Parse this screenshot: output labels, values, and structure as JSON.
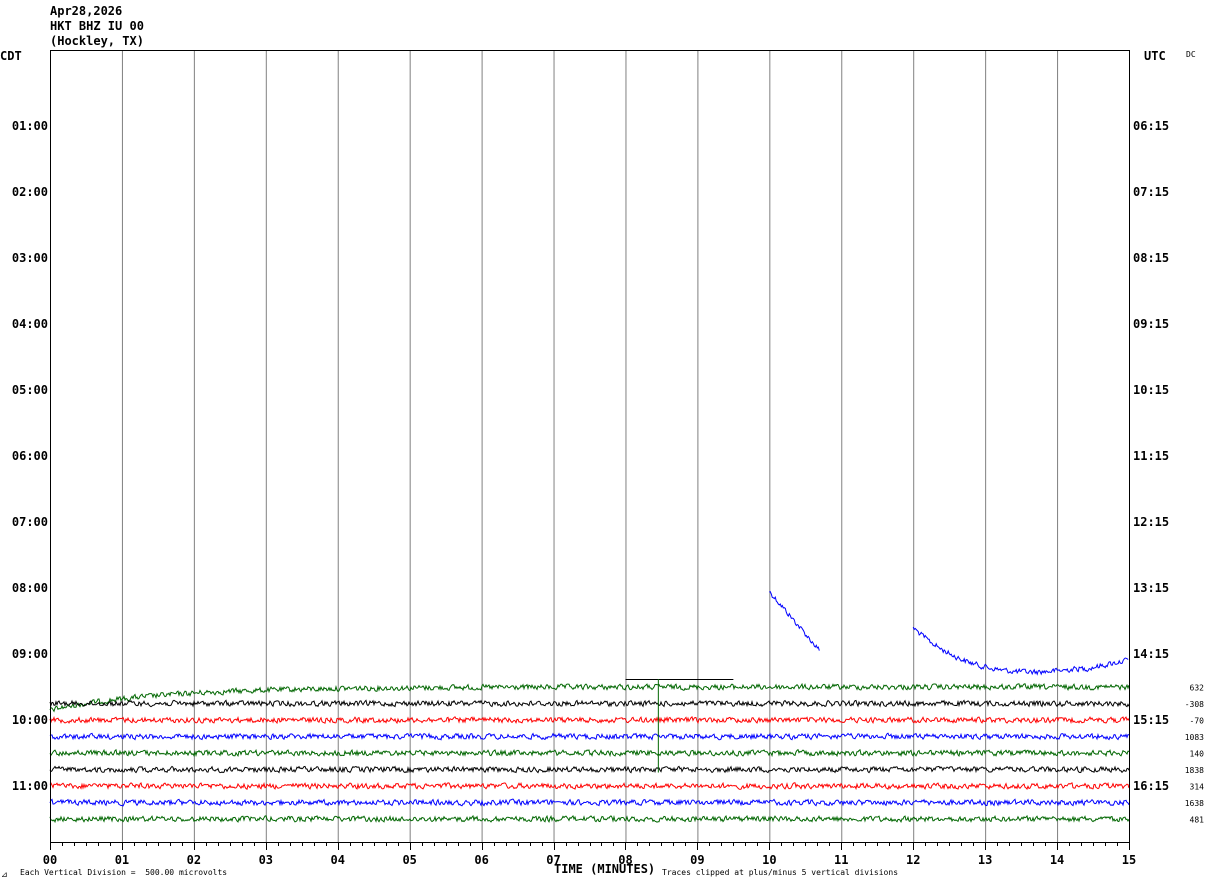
{
  "header": {
    "date": "Apr28,2026",
    "station": "HKT BHZ IU 00",
    "location": "(Hockley, TX)"
  },
  "left_zone": "CDT",
  "right_zone": "UTC",
  "dc_label": "DC",
  "footer": {
    "xaxis_title": "TIME (MINUTES)",
    "scale_note": "Each Vertical Division =  500.00 microvolts",
    "clip_note": "Traces clipped at plus/minus 5 vertical divisions",
    "corner_mark": "⊿"
  },
  "chart_data": {
    "type": "line",
    "title": "HKT BHZ IU 00 (Hockley, TX) Apr28,2026",
    "xlabel": "TIME (MINUTES)",
    "xlim": [
      0,
      15
    ],
    "x_ticks": [
      "00",
      "01",
      "02",
      "03",
      "04",
      "05",
      "06",
      "07",
      "08",
      "09",
      "10",
      "11",
      "12",
      "13",
      "14",
      "15"
    ],
    "left_ticks": [
      "01:00",
      "02:00",
      "03:00",
      "04:00",
      "05:00",
      "06:00",
      "07:00",
      "08:00",
      "09:00",
      "10:00",
      "11:00"
    ],
    "right_ticks": [
      "06:15",
      "07:15",
      "08:15",
      "09:15",
      "10:15",
      "11:15",
      "12:15",
      "13:15",
      "14:15",
      "15:15",
      "16:15"
    ],
    "rows_per_hour": 4,
    "first_row_offset_hours": 0.25,
    "trace_colors": [
      "#000000",
      "#ff0000",
      "#0000ff",
      "#006600"
    ],
    "traces": [
      {
        "color": "#0000ff",
        "row_hours": 8.5,
        "x_start": 10.0,
        "x_end": 10.7,
        "offset_start": 1.8,
        "offset_end": -1.8
      },
      {
        "color": "#0000ff",
        "row_hours": 9.25,
        "x_start": 12.0,
        "x_end": 15.0,
        "shape": "drift",
        "offset_start": 2.6,
        "offset_end": 0.2
      },
      {
        "color": "#006600",
        "row_hours": 9.5,
        "x_start": 0.0,
        "x_end": 15.0,
        "shape": "settle",
        "offset_start": -1.4,
        "offset_end": 0.0
      },
      {
        "color": "#000000",
        "row_hours": 9.75,
        "x_start": 0.0,
        "x_end": 15.0
      },
      {
        "color": "#ff0000",
        "row_hours": 10.0,
        "x_start": 0.0,
        "x_end": 15.0
      },
      {
        "color": "#0000ff",
        "row_hours": 10.25,
        "x_start": 0.0,
        "x_end": 15.0
      },
      {
        "color": "#006600",
        "row_hours": 10.5,
        "x_start": 0.0,
        "x_end": 15.0
      },
      {
        "color": "#000000",
        "row_hours": 10.75,
        "x_start": 0.0,
        "x_end": 15.0
      },
      {
        "color": "#ff0000",
        "row_hours": 11.0,
        "x_start": 0.0,
        "x_end": 15.0
      },
      {
        "color": "#0000ff",
        "row_hours": 11.25,
        "x_start": 0.0,
        "x_end": 15.0
      },
      {
        "color": "#006600",
        "row_hours": 11.5,
        "x_start": 0.0,
        "x_end": 15.0
      }
    ],
    "row_values": [
      "632",
      "-308",
      "-70",
      "1083",
      "140",
      "1838",
      "314",
      "1638",
      "481"
    ],
    "calibration_bar": {
      "x_start": 8.0,
      "x_end": 9.5,
      "marker_x": 8.45,
      "row_hours": 9.5
    }
  }
}
